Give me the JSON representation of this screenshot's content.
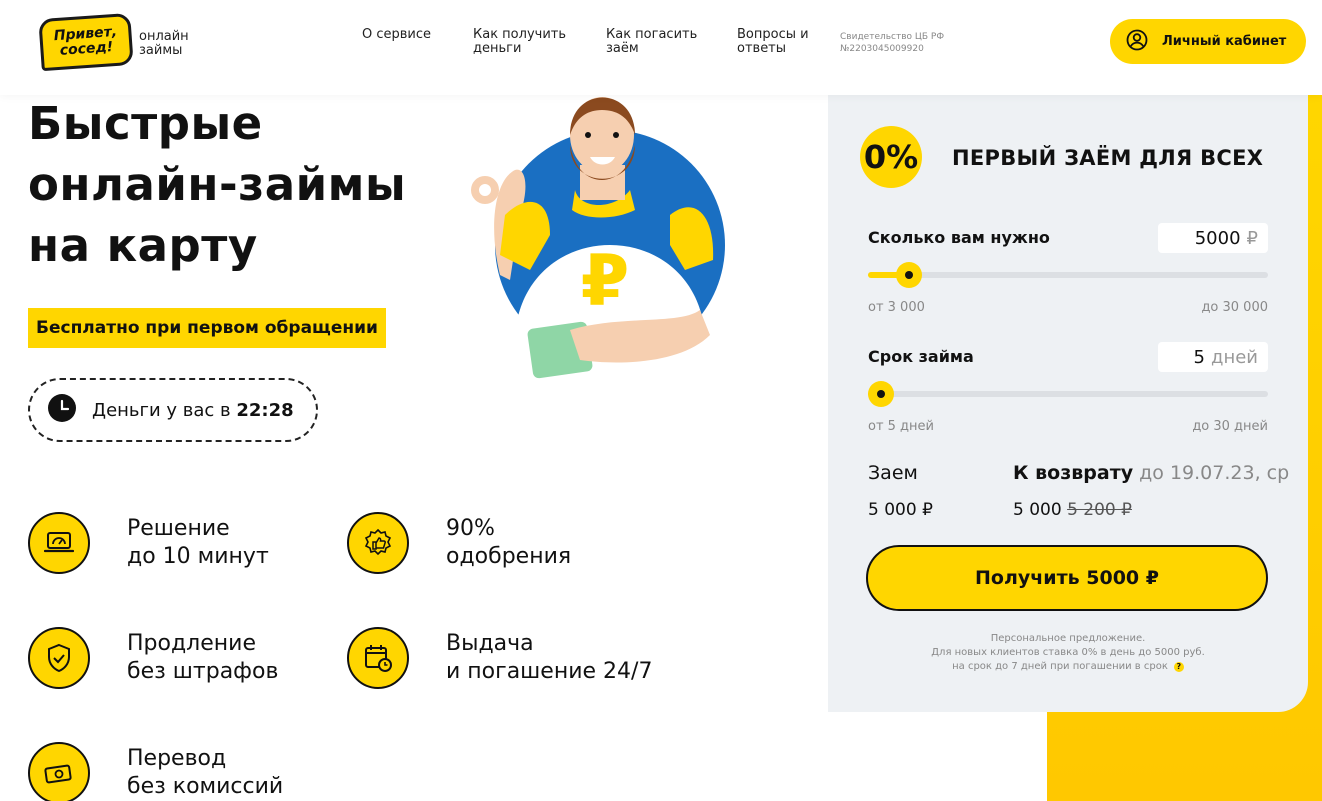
{
  "header": {
    "logo_line1": "Привет,",
    "logo_line2": "сосед!",
    "logo_sub": "онлайн займы",
    "nav": [
      {
        "label": "О сервисе"
      },
      {
        "label": "Как получить деньги"
      },
      {
        "label": "Как погасить заём"
      },
      {
        "label": "Вопросы и ответы"
      }
    ],
    "license": "Свидетельство ЦБ РФ №2203045009920",
    "cabinet_label": "Личный кабинет"
  },
  "hero": {
    "title": "Быстрые онлайн-займы на карту",
    "free_badge": "Бесплатно при первом обращении",
    "timer_text": "Деньги у вас в",
    "timer_time": "22:28"
  },
  "features": [
    {
      "line1": "Решение",
      "line2": "до 10 минут",
      "icon": "laptop-speedometer-icon"
    },
    {
      "line1": "90%",
      "line2": "одобрения",
      "icon": "thumbs-up-icon"
    },
    {
      "line1": "Продление",
      "line2": "без штрафов",
      "icon": "shield-check-icon"
    },
    {
      "line1": "Выдача",
      "line2": "и погашение 24/7",
      "icon": "calendar-clock-icon"
    },
    {
      "line1": "Перевод",
      "line2": "без комиссий",
      "icon": "cash-icon"
    }
  ],
  "calculator": {
    "zero_badge": "0%",
    "heading": "ПЕРВЫЙ ЗАЁМ ДЛЯ ВСЕХ",
    "amount": {
      "label": "Сколько вам нужно",
      "value": "5000",
      "unit": "₽",
      "min_label": "от 3 000",
      "max_label": "до 30 000",
      "min": 3000,
      "max": 30000,
      "current": 5000
    },
    "term": {
      "label": "Срок займа",
      "value": "5",
      "unit": "дней",
      "min_label": "от 5 дней",
      "max_label": "до 30 дней",
      "min": 5,
      "max": 30,
      "current": 5
    },
    "loan_label": "Заем",
    "loan_value": "5 000 ₽",
    "return_label": "К возврату",
    "return_date": "до 19.07.23, ср",
    "return_value": "5 000",
    "return_old": "5 200 ₽",
    "submit_label": "Получить 5000 ₽",
    "note_line1": "Персональное предложение.",
    "note_line2": "Для новых клиентов ставка 0% в день до 5000 руб.",
    "note_line3": "на срок до 7 дней при погашении в срок",
    "note_help": "?"
  },
  "colors": {
    "accent": "#ffd600",
    "calc_bg": "#eef1f4",
    "illustration_circle": "#1a6fc2"
  }
}
